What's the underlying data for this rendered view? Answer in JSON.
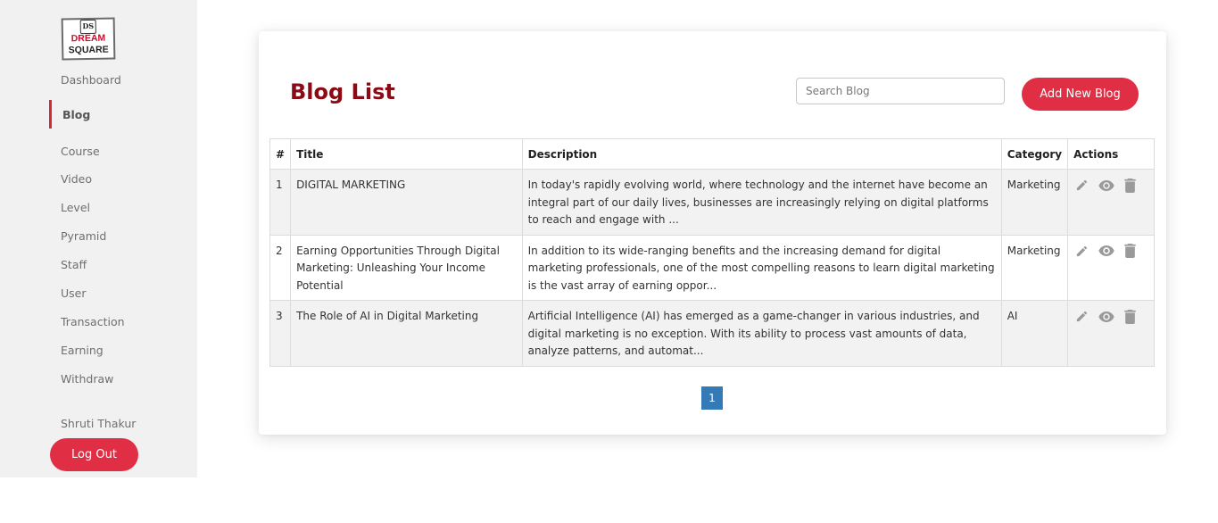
{
  "sidebar": {
    "logo": {
      "badge": "DS",
      "line1": "DREAM",
      "line2": "SQUARE"
    },
    "items": [
      {
        "label": "Dashboard"
      },
      {
        "label": "Blog"
      },
      {
        "label": "Course"
      },
      {
        "label": "Video"
      },
      {
        "label": "Level"
      },
      {
        "label": "Pyramid"
      },
      {
        "label": "Staff"
      },
      {
        "label": "User"
      },
      {
        "label": "Transaction"
      },
      {
        "label": "Earning"
      },
      {
        "label": "Withdraw"
      }
    ],
    "active_item": "Blog",
    "user_name": "Shruti Thakur",
    "logout_label": "Log Out"
  },
  "main": {
    "title": "Blog List",
    "search_placeholder": "Search Blog",
    "search_value": "",
    "add_button_label": "Add New Blog",
    "table": {
      "headers": [
        "#",
        "Title",
        "Description",
        "Category",
        "Actions"
      ],
      "rows": [
        {
          "num": "1",
          "title": "DIGITAL MARKETING",
          "description": "In today's rapidly evolving world, where technology and the internet have become an integral part of our daily lives, businesses are increasingly relying on digital platforms to reach and engage with ...",
          "category": "Marketing"
        },
        {
          "num": "2",
          "title": "Earning Opportunities Through Digital Marketing: Unleashing Your Income Potential",
          "description": "In addition to its wide-ranging benefits and the increasing demand for digital marketing professionals, one of the most compelling reasons to learn digital marketing is the vast array of earning oppor...",
          "category": "Marketing"
        },
        {
          "num": "3",
          "title": "The Role of AI in Digital Marketing",
          "description": "Artificial Intelligence (AI) has emerged as a game-changer in various industries, and digital marketing is no exception. With its ability to process vast amounts of data, analyze patterns, and automat...",
          "category": "AI"
        }
      ],
      "row_actions": [
        "edit-icon",
        "view-icon",
        "delete-icon"
      ]
    },
    "pagination": {
      "current_page": "1"
    }
  },
  "colors": {
    "accent": "#e02f45",
    "title": "#8b0a14",
    "pager": "#337ab7",
    "sidebar_bg": "#f1f1f1"
  }
}
